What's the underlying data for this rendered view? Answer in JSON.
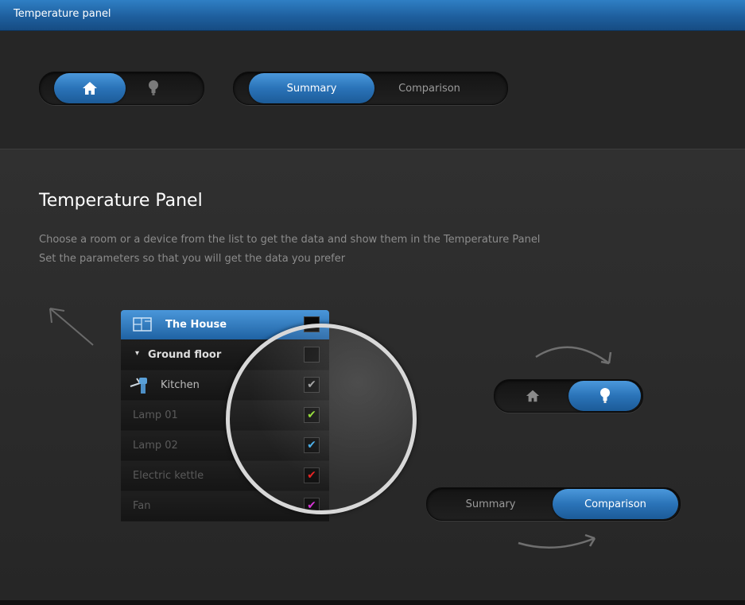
{
  "window": {
    "title": "Temperature panel"
  },
  "toolbar": {
    "view_toggle": {
      "home_icon": "house-icon",
      "device_icon": "bulb-icon",
      "active": "home"
    },
    "mode_toggle": {
      "summary": "Summary",
      "comparison": "Comparison",
      "active": "summary"
    }
  },
  "main": {
    "heading": "Temperature Panel",
    "description": [
      "Choose a room or a device from the list to get the data and show them in the Temperature Panel",
      "Set the parameters so that you will get the data you prefer"
    ]
  },
  "illustration": {
    "list": {
      "house": "The House",
      "floor": "Ground floor",
      "room": "Kitchen",
      "devices": [
        {
          "label": "Lamp 01",
          "check": "✔",
          "color": "#8cd92a"
        },
        {
          "label": "Lamp 02",
          "check": "✔",
          "color": "#3fa9e6"
        },
        {
          "label": "Electric kettle",
          "check": "✔",
          "color": "#e81c1c"
        },
        {
          "label": "Fan",
          "check": "✔",
          "color": "#d630d6"
        }
      ]
    },
    "example_view_toggle": {
      "active": "device"
    },
    "example_mode_toggle": {
      "summary": "Summary",
      "comparison": "Comparison",
      "active": "comparison"
    }
  },
  "colors": {
    "accent": "#2a73b8",
    "titlebar": "#1e5f9e",
    "background": "#2a2a2a"
  }
}
